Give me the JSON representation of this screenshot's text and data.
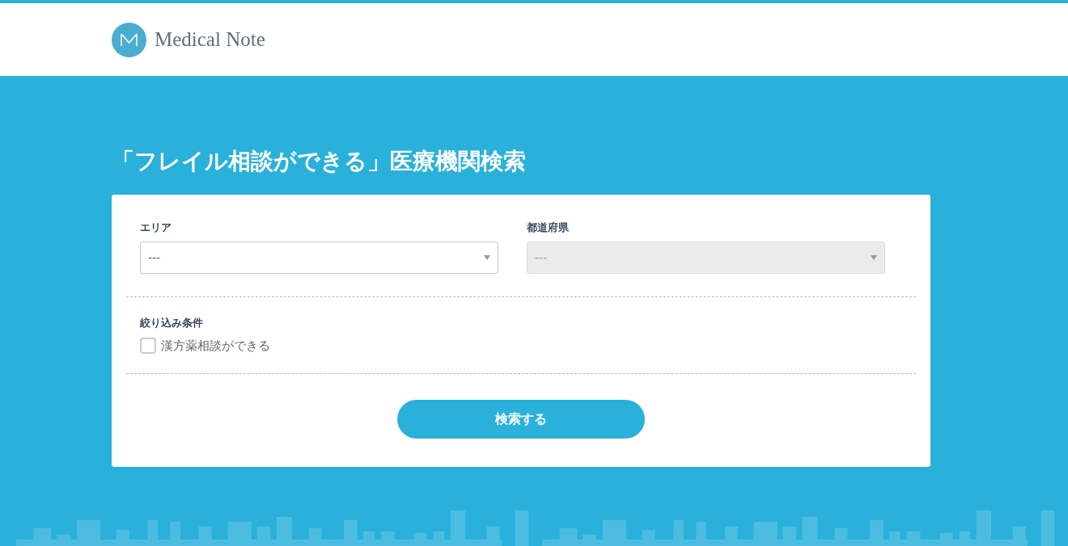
{
  "header": {
    "logo_text": "Medical Note"
  },
  "title": "「フレイル相談ができる」医療機関検索",
  "fields": [
    {
      "label": "エリア",
      "value": "---",
      "disabled": false
    },
    {
      "label": "都道府県",
      "value": "---",
      "disabled": true
    }
  ],
  "filters": {
    "heading": "絞り込み条件",
    "options": [
      {
        "label": "漢方薬相談ができる",
        "checked": false
      }
    ]
  },
  "submit": "検索する"
}
